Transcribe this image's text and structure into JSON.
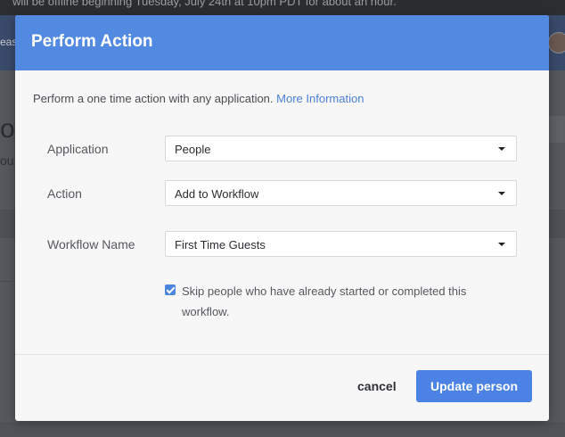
{
  "background": {
    "banner_text": "will be offline beginning Tuesday, July 24th at 10pm PDT for about an hour.",
    "nav_fragment": "eas",
    "heading_fragment": "od",
    "sub_fragment": "ou"
  },
  "modal": {
    "title": "Perform Action",
    "intro": "Perform a one time action with any application.",
    "intro_link": "More Information",
    "fields": {
      "application": {
        "label": "Application",
        "value": "People"
      },
      "action": {
        "label": "Action",
        "value": "Add to Workflow"
      },
      "workflow": {
        "label": "Workflow Name",
        "value": "First Time Guests"
      }
    },
    "skip_checkbox": {
      "checked": true,
      "label": "Skip people who have already started or completed this workflow."
    },
    "cancel_label": "cancel",
    "submit_label": "Update person"
  },
  "colors": {
    "accent": "#5289e1",
    "button": "#4b82e3",
    "link": "#4a7fd4"
  },
  "icons": {
    "select_caret": "caret-down-icon",
    "checkbox": "checkmark-icon"
  }
}
